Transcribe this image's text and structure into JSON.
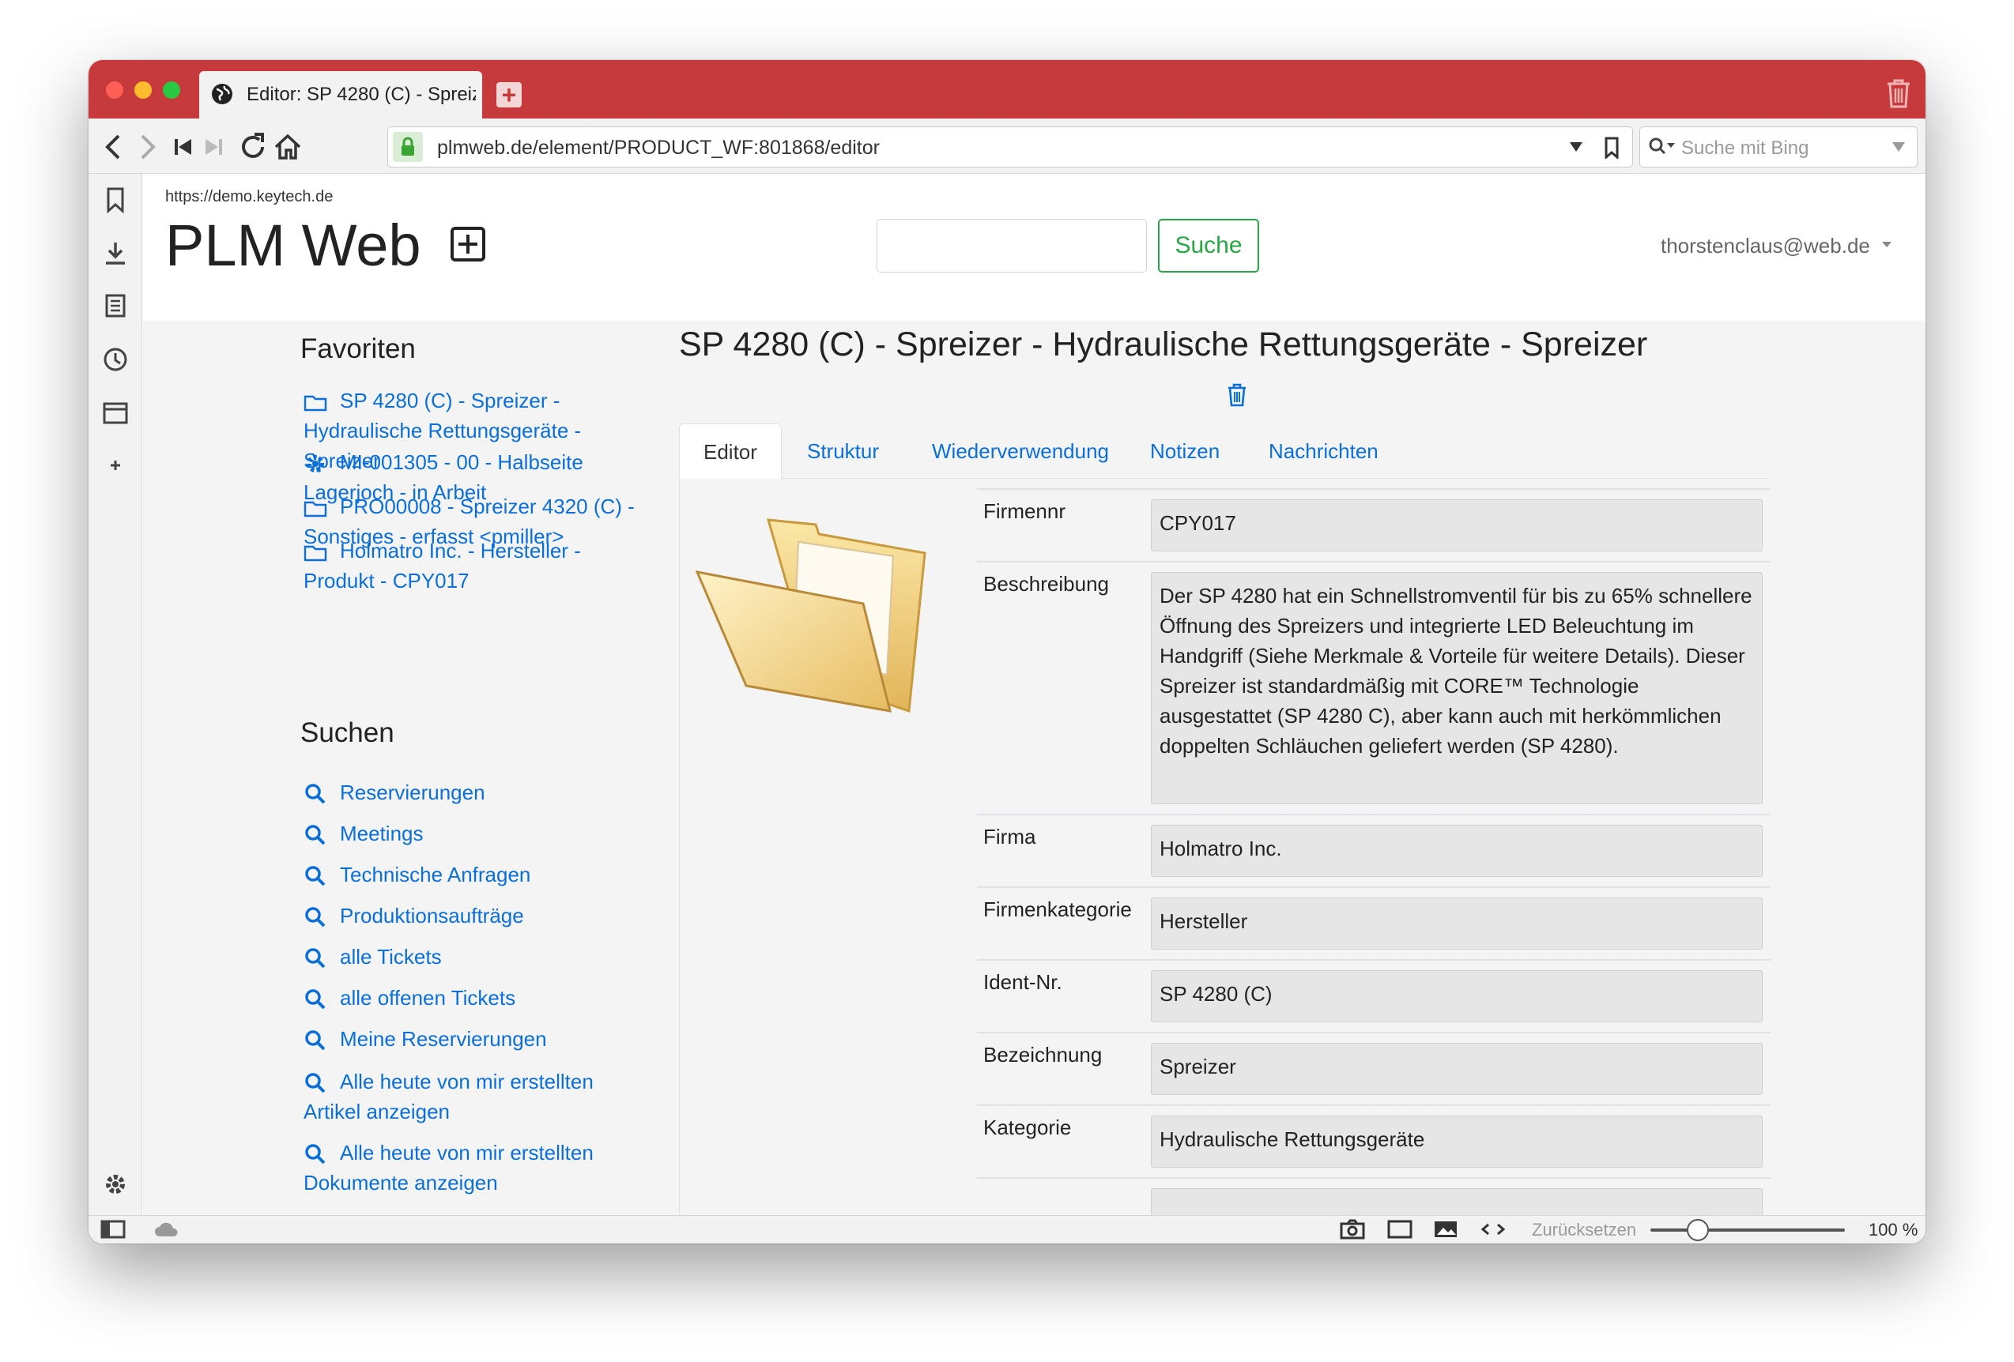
{
  "browser": {
    "tab_title": "Editor: SP 4280 (C) - Spreizer - Hydraulische Rettungsgeräte - Spreizer",
    "url": "plmweb.de/element/PRODUCT_WF:801868/editor",
    "search_placeholder": "Suche mit Bing",
    "zoom_reset_label": "Zurücksetzen",
    "zoom_value": "100 %",
    "zoom_fraction": 0.2
  },
  "header": {
    "domain": "https://demo.keytech.de",
    "brand": "PLM Web",
    "search_button": "Suche",
    "user": "thorstenclaus@web.de"
  },
  "sidebar": {
    "favorites_heading": "Favoriten",
    "favorites": [
      {
        "icon": "folder-icon",
        "label": "SP 4280 (C) - Spreizer - Hydraulische Rettungsgeräte - Spreizer"
      },
      {
        "icon": "gear-icon",
        "label": "MI-001305 - 00 - Halbseite Lagerjoch - in Arbeit"
      },
      {
        "icon": "folder-icon",
        "label": "PRO00008 - Spreizer 4320 (C) - Sonstiges - erfasst <pmiller>"
      },
      {
        "icon": "folder-icon",
        "label": "Holmatro Inc. - Hersteller - Produkt - CPY017"
      }
    ],
    "search_heading": "Suchen",
    "searches": [
      "Reservierungen",
      "Meetings",
      "Technische Anfragen",
      "Produktionsaufträge",
      "alle Tickets",
      "alle offenen Tickets",
      "Meine Reservierungen",
      "Alle heute von mir erstellten Artikel anzeigen",
      "Alle heute von mir erstellten Dokumente anzeigen",
      "Alle heute von mir erstellten"
    ]
  },
  "page": {
    "title": "SP 4280 (C) - Spreizer - Hydraulische Rettungsgeräte - Spreizer",
    "tabs": [
      "Editor",
      "Struktur",
      "Wiederverwendung",
      "Notizen",
      "Nachrichten"
    ],
    "active_tab": "Editor",
    "fields": [
      {
        "label": "Firmennr",
        "value": "CPY017"
      },
      {
        "label": "Beschreibung",
        "value": "Der SP 4280 hat ein Schnellstromventil für bis zu 65% schnellere Öffnung des Spreizers und integrierte LED Beleuchtung im Handgriff (Siehe Merkmale & Vorteile für weitere Details). Dieser Spreizer ist standardmäßig mit CORE™ Technologie ausgestattet (SP 4280 C), aber kann auch mit herkömmlichen doppelten Schläuchen geliefert werden (SP 4280)."
      },
      {
        "label": "Firma",
        "value": "Holmatro Inc."
      },
      {
        "label": "Firmenkategorie",
        "value": "Hersteller"
      },
      {
        "label": "Ident-Nr.",
        "value": "SP 4280 (C)"
      },
      {
        "label": "Bezeichnung",
        "value": "Spreizer"
      },
      {
        "label": "Kategorie",
        "value": "Hydraulische Rettungsgeräte"
      }
    ]
  },
  "colors": {
    "titlebar": "#c73a3c",
    "link": "#0a6fd8",
    "search_button": "#28a745"
  }
}
